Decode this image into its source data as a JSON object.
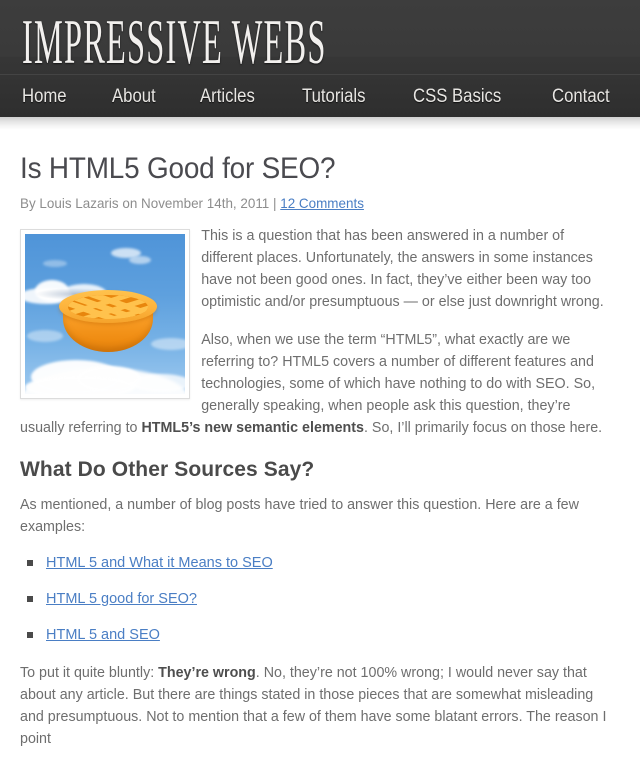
{
  "site": {
    "logo": "IMPRESSIVE WEBS",
    "nav": [
      {
        "label": "Home"
      },
      {
        "label": "About"
      },
      {
        "label": "Articles"
      },
      {
        "label": "Tutorials"
      },
      {
        "label": "CSS Basics"
      },
      {
        "label": "Contact"
      }
    ],
    "colors": {
      "header_bg": "#3a3a3a",
      "nav_bg": "#303030",
      "link": "#4a7ec4",
      "body_text": "#6e6e6e",
      "heading": "#4a4a4a",
      "title": "#4a4a4f",
      "meta": "#8d8d8d"
    }
  },
  "post": {
    "title": "Is HTML5 Good for SEO?",
    "meta": {
      "byline": "By Louis Lazaris on November 14th, 2011 | ",
      "comments_link": "12 Comments"
    },
    "thumbnail": {
      "alt": "pie-in-the-sky-image",
      "description": "An orange lattice-crust pie floating in a blue sky with white clouds"
    },
    "paragraphs": {
      "p1": "This is a question that has been answered in a number of different places. Unfortunately, the answers in some instances have not been good ones. In fact, they’ve either been way too optimistic and/or presumptuous — or else just downright wrong.",
      "p2_part1": "Also, when we use the term “HTML5”, what exactly are we referring to? HTML5 covers a number of different features and technologies, some of which have nothing to do with SEO. So, generally speaking, when people ask this question, they’re usually referring to ",
      "p2_bold": "HTML5’s new semantic elements",
      "p2_part2": ". So, I’ll primarily focus on those here.",
      "p3_intro": "As mentioned, a number of blog posts have tried to answer this question. Here are a few examples:",
      "p4_part1": "To put it quite bluntly: ",
      "p4_bold": "They’re wrong",
      "p4_part2": ". No, they’re not 100% wrong; I would never say that about any article. But there are things stated in those pieces that are somewhat misleading and presumptuous. Not to mention that a few of them have some blatant errors. The reason I point"
    },
    "section_heading": "What Do Other Sources Say?",
    "source_links": [
      {
        "label": "HTML 5 and What it Means to SEO"
      },
      {
        "label": "HTML 5 good for SEO?"
      },
      {
        "label": "HTML 5 and SEO"
      }
    ]
  }
}
